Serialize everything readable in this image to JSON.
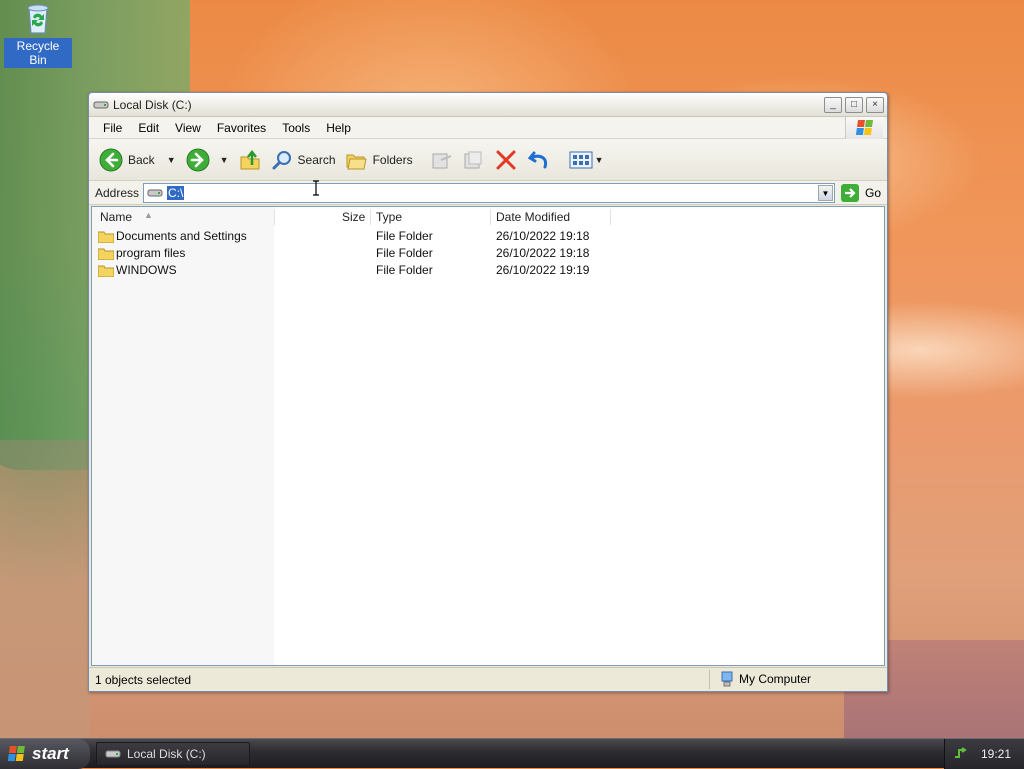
{
  "desktop": {
    "icons": [
      {
        "label": "Recycle Bin",
        "icon": "recycle-bin-icon"
      }
    ]
  },
  "window": {
    "title": "Local Disk (C:)",
    "buttons": {
      "minimize": "_",
      "maximize": "□",
      "close": "×"
    },
    "menu": [
      "File",
      "Edit",
      "View",
      "Favorites",
      "Tools",
      "Help"
    ],
    "toolbar": {
      "back": "Back",
      "search": "Search",
      "folders": "Folders"
    },
    "address": {
      "label": "Address",
      "value": "C:\\",
      "go": "Go"
    },
    "columns": {
      "name": "Name",
      "size": "Size",
      "type": "Type",
      "modified": "Date Modified"
    },
    "rows": [
      {
        "name": "Documents and Settings",
        "size": "",
        "type": "File Folder",
        "modified": "26/10/2022 19:18"
      },
      {
        "name": "program files",
        "size": "",
        "type": "File Folder",
        "modified": "26/10/2022 19:18"
      },
      {
        "name": "WINDOWS",
        "size": "",
        "type": "File Folder",
        "modified": "26/10/2022 19:19"
      }
    ],
    "status": {
      "left": "1 objects selected",
      "right": "My Computer"
    }
  },
  "taskbar": {
    "start": "start",
    "tasks": [
      {
        "label": "Local Disk (C:)"
      }
    ],
    "clock": "19:21"
  },
  "colors": {
    "selection": "#316ac5",
    "taskbar": "#2c2c30",
    "window": "#ece9d8"
  }
}
